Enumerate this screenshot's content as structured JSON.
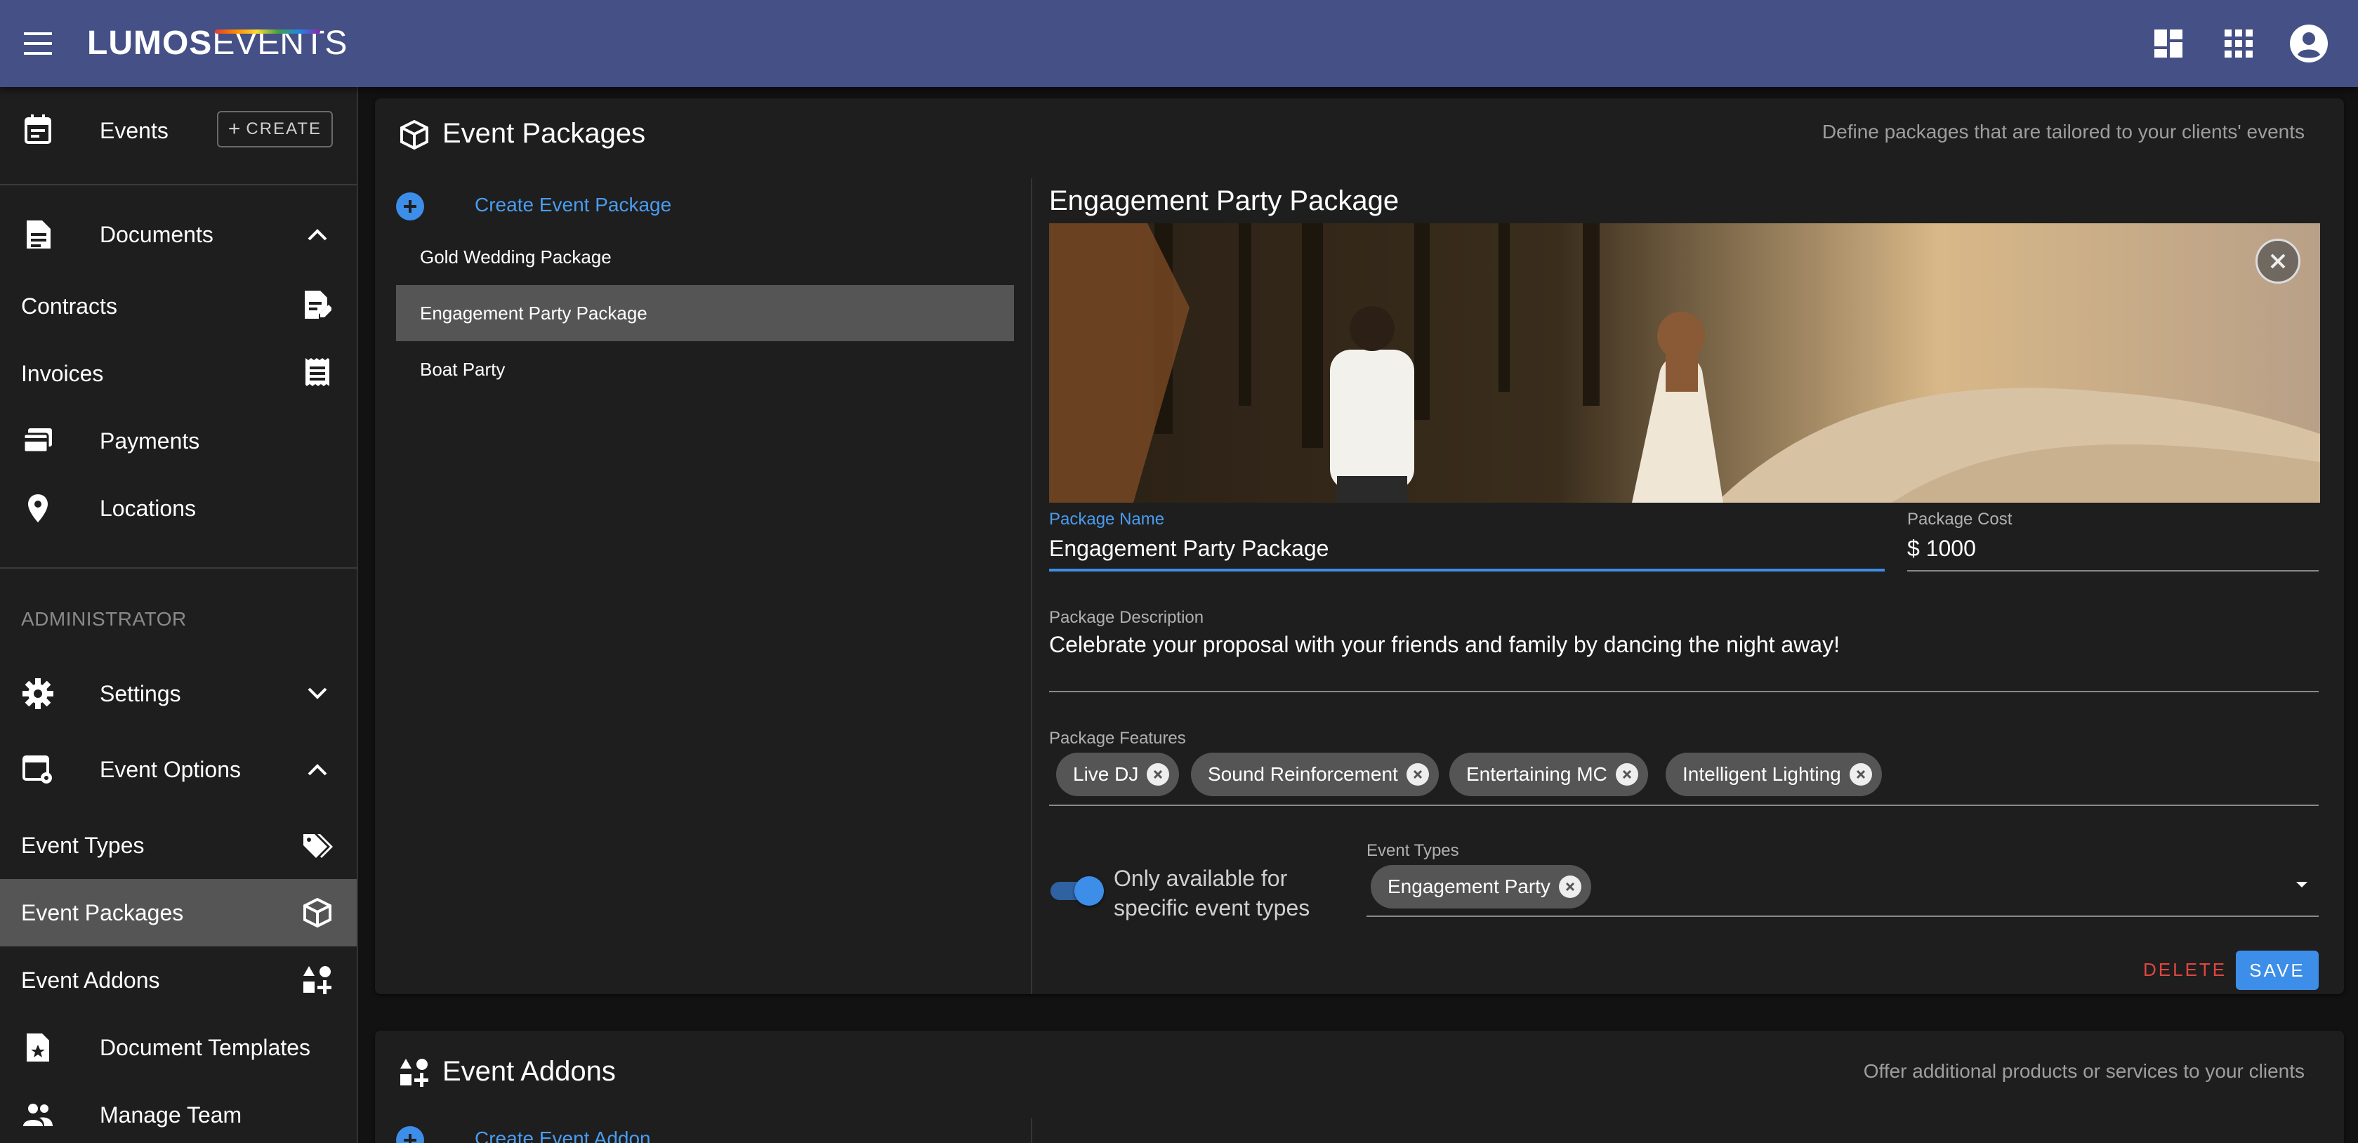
{
  "app": {
    "logo_bold": "LUMOS",
    "logo_light": "EVENTS"
  },
  "sidebar": {
    "events": {
      "label": "Events",
      "create_label": "CREATE"
    },
    "documents": {
      "label": "Documents"
    },
    "contracts": {
      "label": "Contracts"
    },
    "invoices": {
      "label": "Invoices"
    },
    "payments": {
      "label": "Payments"
    },
    "locations": {
      "label": "Locations"
    },
    "admin_header": "ADMINISTRATOR",
    "settings": {
      "label": "Settings"
    },
    "event_options": {
      "label": "Event Options"
    },
    "event_types": {
      "label": "Event Types"
    },
    "event_packages": {
      "label": "Event Packages"
    },
    "event_addons": {
      "label": "Event Addons"
    },
    "document_templates": {
      "label": "Document Templates"
    },
    "manage_team": {
      "label": "Manage Team"
    }
  },
  "packages_card": {
    "title": "Event Packages",
    "subtitle": "Define packages that are tailored to your clients' events",
    "create_label": "Create Event Package",
    "items": [
      "Gold Wedding Package",
      "Engagement Party Package",
      "Boat Party"
    ],
    "selected_index": 1
  },
  "detail": {
    "title": "Engagement Party Package",
    "name_label": "Package Name",
    "name_value": "Engagement Party Package",
    "cost_label": "Package Cost",
    "cost_value": "$ 1000",
    "description_label": "Package Description",
    "description_value": "Celebrate your proposal with your friends and family by dancing the night away!",
    "features_label": "Package Features",
    "features": [
      "Live DJ",
      "Sound Reinforcement",
      "Entertaining MC",
      "Intelligent Lighting"
    ],
    "toggle_label": "Only available for specific event types",
    "toggle_on": true,
    "event_types_label": "Event Types",
    "event_types": [
      "Engagement Party"
    ],
    "delete_label": "DELETE",
    "save_label": "SAVE"
  },
  "addons_card": {
    "title": "Event Addons",
    "subtitle": "Offer additional products or services to your clients",
    "create_label": "Create Event Addon"
  },
  "colors": {
    "appbar": "#445086",
    "accent": "#3d8ee8",
    "danger": "#e0473f",
    "surface": "#1e1e1e",
    "active": "#555555"
  }
}
